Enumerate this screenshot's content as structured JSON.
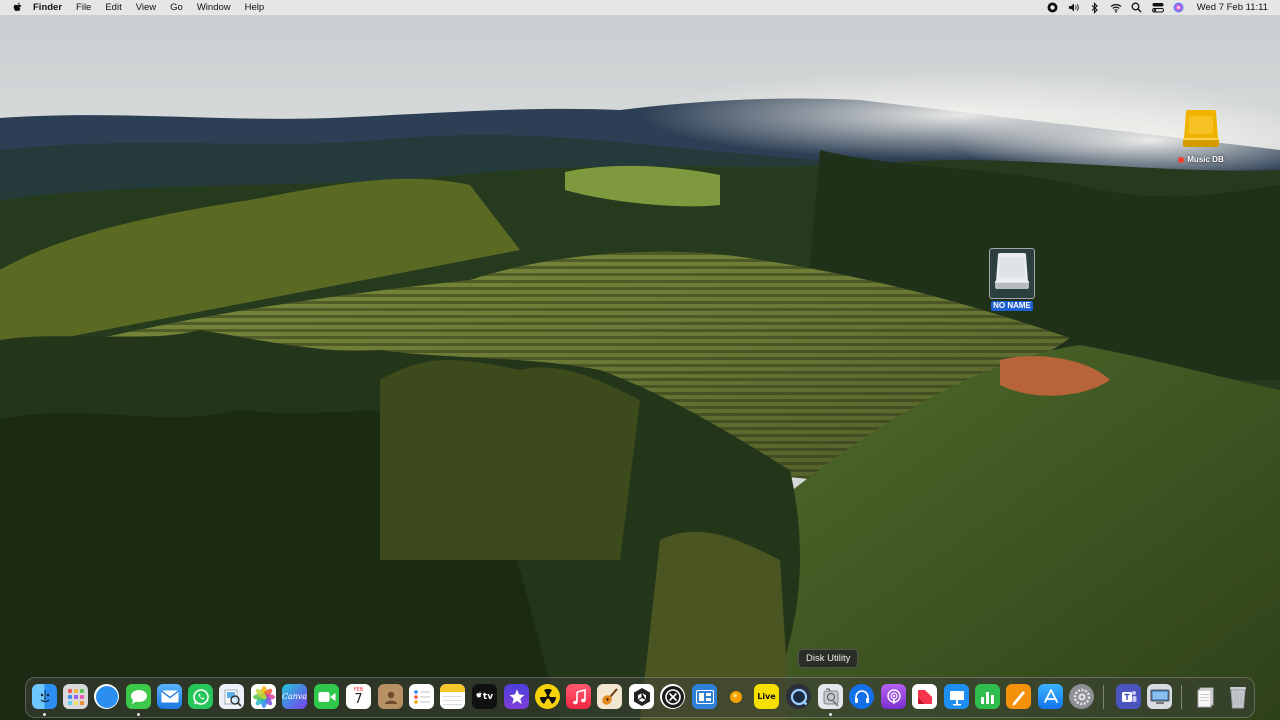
{
  "menubar": {
    "app_name": "Finder",
    "menus": [
      "File",
      "Edit",
      "View",
      "Go",
      "Window",
      "Help"
    ],
    "status_icons": [
      "record-icon",
      "volume-icon",
      "bluetooth-icon",
      "wifi-icon",
      "search-icon",
      "control-center-icon",
      "siri-icon"
    ],
    "clock": "Wed 7 Feb  11:11"
  },
  "desktop": {
    "icons": [
      {
        "label": "Music DB",
        "icon": "external-drive-icon",
        "tag_color": "#ff3b30"
      },
      {
        "label": "NO NAME",
        "icon": "removable-disk-icon",
        "selected": true
      }
    ]
  },
  "dock": {
    "tooltip": "Disk Utility",
    "apps": [
      {
        "name": "Finder",
        "icon": "finder-icon",
        "running": true
      },
      {
        "name": "Launchpad",
        "icon": "launchpad-icon"
      },
      {
        "name": "Safari",
        "icon": "safari-icon"
      },
      {
        "name": "Messages",
        "icon": "messages-icon",
        "running": true
      },
      {
        "name": "Mail",
        "icon": "mail-icon"
      },
      {
        "name": "WhatsApp",
        "icon": "whatsapp-icon"
      },
      {
        "name": "Preview",
        "icon": "preview-icon"
      },
      {
        "name": "Photos",
        "icon": "photos-icon"
      },
      {
        "name": "Canva",
        "icon": "canva-icon",
        "text": "Canva"
      },
      {
        "name": "FaceTime",
        "icon": "facetime-icon"
      },
      {
        "name": "Calendar",
        "icon": "calendar-icon",
        "text": "7",
        "subtext": "FEB"
      },
      {
        "name": "Contacts",
        "icon": "contacts-icon"
      },
      {
        "name": "Reminders",
        "icon": "reminders-icon"
      },
      {
        "name": "Notes",
        "icon": "notes-icon"
      },
      {
        "name": "Apple TV",
        "icon": "tv-icon",
        "text": "tv"
      },
      {
        "name": "iMovie",
        "icon": "imovie-icon"
      },
      {
        "name": "Radiation",
        "icon": "radiation-icon"
      },
      {
        "name": "Music",
        "icon": "music-icon"
      },
      {
        "name": "GarageBand",
        "icon": "guitar-icon"
      },
      {
        "name": "Unity Hub",
        "icon": "unity-icon"
      },
      {
        "name": "Logic Remote",
        "icon": "circle-x-icon"
      },
      {
        "name": "Widgets",
        "icon": "widgets-icon"
      },
      {
        "name": "Amphetamine",
        "icon": "orange-dot-icon"
      },
      {
        "name": "Live",
        "icon": "live-icon",
        "text": "Live"
      },
      {
        "name": "QuickTime Player",
        "icon": "quicktime-icon"
      },
      {
        "name": "Disk Utility",
        "icon": "disk-utility-icon",
        "running": true
      },
      {
        "name": "Podcast Capture",
        "icon": "headset-icon"
      },
      {
        "name": "Podcasts",
        "icon": "podcasts-icon"
      },
      {
        "name": "News",
        "icon": "news-icon"
      },
      {
        "name": "Keynote",
        "icon": "keynote-icon"
      },
      {
        "name": "Numbers",
        "icon": "numbers-icon"
      },
      {
        "name": "Pages",
        "icon": "pages-icon"
      },
      {
        "name": "App Store",
        "icon": "app-store-icon"
      },
      {
        "name": "System Settings",
        "icon": "settings-icon"
      },
      {
        "name": "Microsoft Teams",
        "icon": "teams-icon"
      },
      {
        "name": "Screen Sharing",
        "icon": "screen-icon"
      },
      {
        "name": "Documents",
        "icon": "documents-stack-icon"
      },
      {
        "name": "Trash",
        "icon": "trash-icon"
      }
    ]
  },
  "colors": {
    "selection": "#1d5fd1",
    "tag_red": "#ff3b30"
  }
}
